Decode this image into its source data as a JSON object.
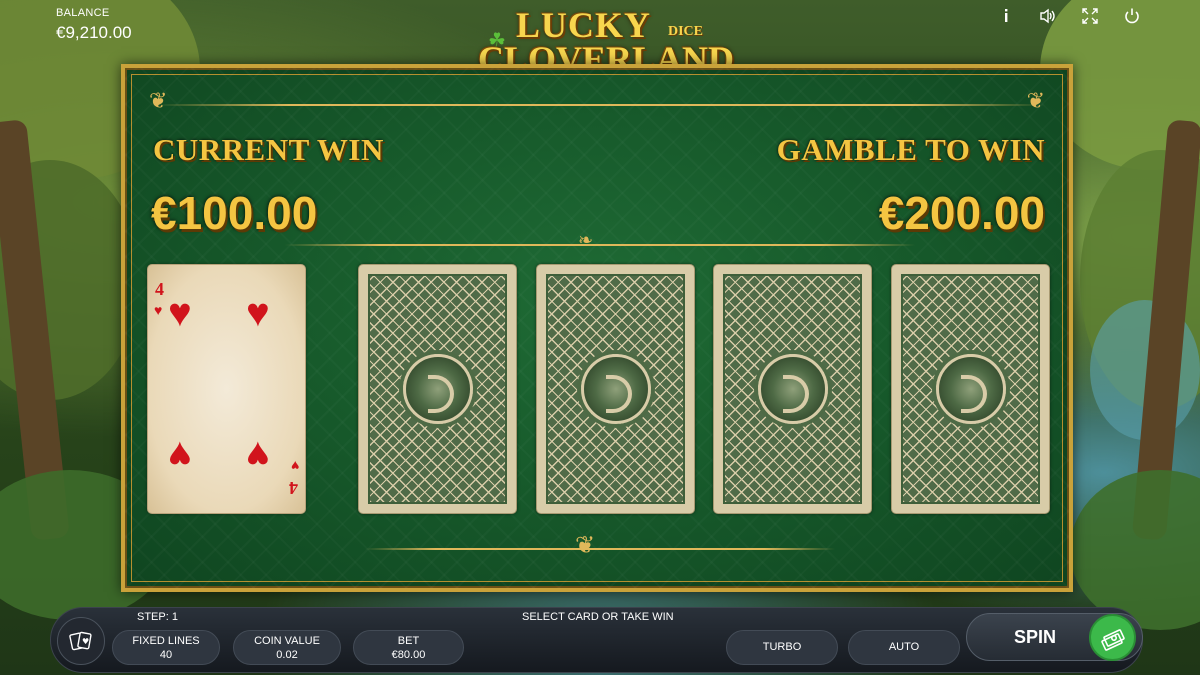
{
  "hud": {
    "balance_label": "BALANCE",
    "balance_value": "€9,210.00",
    "icons": [
      "info-icon",
      "sound-icon",
      "fullscreen-icon",
      "power-icon"
    ]
  },
  "logo": {
    "line1": "LUCKY",
    "line1_suffix": "DICE",
    "line2": "CLOVERLAND"
  },
  "gamble": {
    "current_win_label": "CURRENT WIN",
    "current_win_value": "€100.00",
    "gamble_label": "GAMBLE TO WIN",
    "gamble_value": "€200.00",
    "revealed_card": {
      "rank": "4",
      "suit": "hearts",
      "suit_symbol": "♥"
    },
    "hidden_cards": 4
  },
  "bottom_bar": {
    "step": "STEP: 1",
    "message": "SELECT CARD OR TAKE WIN",
    "fixed_lines_label": "FIXED LINES",
    "fixed_lines_value": "40",
    "coin_value_label": "COIN VALUE",
    "coin_value_value": "0.02",
    "bet_label": "BET",
    "bet_value": "€80.00",
    "turbo_label": "TURBO",
    "auto_label": "AUTO",
    "spin_label": "SPIN"
  },
  "colors": {
    "gold_text": "#f4c542",
    "board_green": "#175a2b",
    "heart_red": "#d1141c",
    "collect_green": "#3cb94a"
  }
}
